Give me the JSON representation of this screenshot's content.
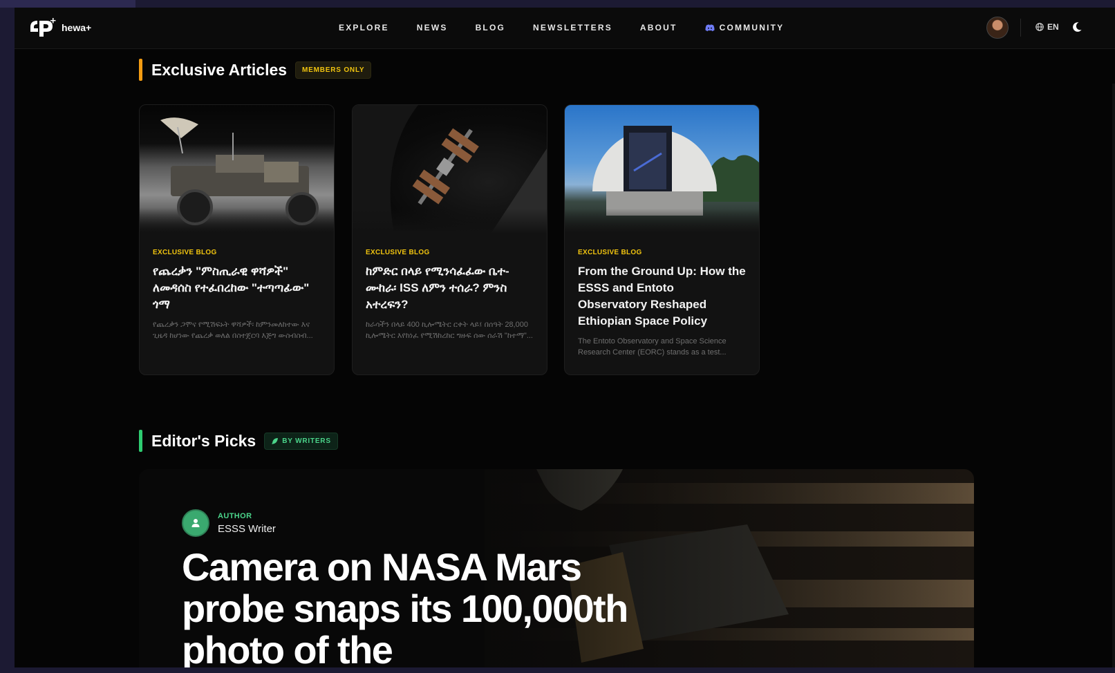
{
  "nav": {
    "logo_text": "hewa+",
    "links": [
      {
        "label": "EXPLORE"
      },
      {
        "label": "NEWS"
      },
      {
        "label": "BLOG"
      },
      {
        "label": "NEWSLETTERS"
      },
      {
        "label": "ABOUT"
      },
      {
        "label": "COMMUNITY",
        "icon": "discord-icon"
      }
    ],
    "language": "EN",
    "theme_icon": "moon-icon"
  },
  "exclusive": {
    "title": "Exclusive Articles",
    "badge": "MEMBERS ONLY",
    "accent_color": "#f39c12",
    "cards": [
      {
        "category": "EXCLUSIVE BLOG",
        "title": "የጨረቃን \"ምስጢራዊ ዋሻዎች\" ለመዳሰስ የተፈበረከው \"ተጣጣፊው\" ጎማ",
        "excerpt": "የጨረቃን ጋሞና የሚሽፍኑት ዋሻዎች፡ ከምንመለከተው እና ጊዜዳ ከሆነው የጨረቃ ወለል በስተጀርባ እጅግ ውስብስብ...",
        "image": "lunar-rover"
      },
      {
        "category": "EXCLUSIVE BLOG",
        "title": "ከምድር በላይ የሚንሳፈፈው ቤተ-ሙከራ፡ ISS ለምን ተሰራ? ምንስ አተረፍን?",
        "excerpt": "ከራሳችን በላይ 400 ኪሎሜትር ርቀት ላይ፤ በሰዓት 28,000 ኪሎሜትር እየከነፈ የሚሽከረከር ግዙፍ ሰው ሰራሽ \"ከተማ\"...",
        "image": "space-station"
      },
      {
        "category": "EXCLUSIVE BLOG",
        "title": "From the Ground Up: How the ESSS and Entoto Observatory Reshaped Ethiopian Space Policy",
        "excerpt": "The Entoto Observatory and Space Science Research Center (EORC) stands as a test...",
        "image": "observatory-dome"
      }
    ]
  },
  "editors": {
    "title": "Editor's Picks",
    "badge": "BY WRITERS",
    "badge_icon": "feather-icon",
    "accent_color": "#2ecc71",
    "hero": {
      "author_label": "AUTHOR",
      "author_name": "ESSS Writer",
      "title": "Camera on NASA Mars probe snaps its 100,000th photo of the"
    }
  }
}
